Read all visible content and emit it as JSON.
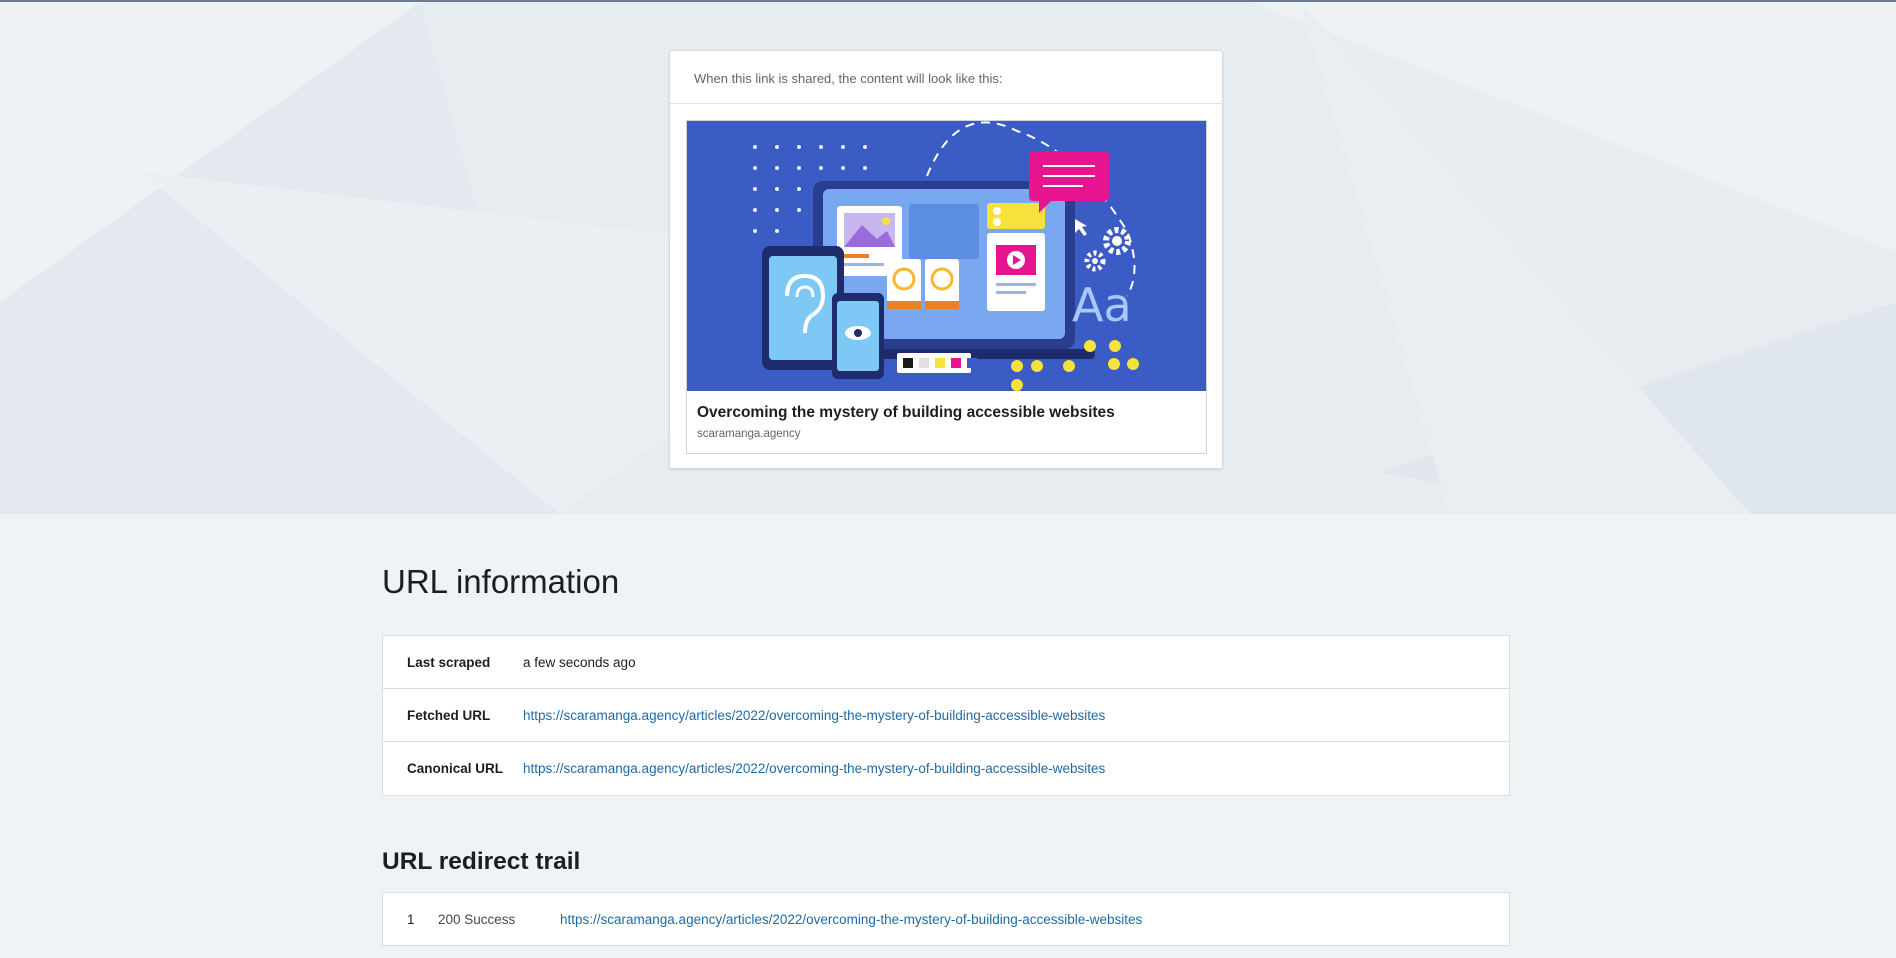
{
  "preview": {
    "header": "When this link is shared, the content will look like this:",
    "title": "Overcoming the mystery of building accessible websites",
    "domain": "scaramanga.agency",
    "image_text": "Aa",
    "colors": {
      "image_bg": "#3b5bc5",
      "accent_magenta": "#e6158f",
      "accent_yellow": "#f5e23b"
    }
  },
  "url_info": {
    "title": "URL information",
    "rows": [
      {
        "label": "Last scraped",
        "value": "a few seconds ago"
      },
      {
        "label": "Fetched URL",
        "value": "https://scaramanga.agency/articles/2022/overcoming-the-mystery-of-building-accessible-websites"
      },
      {
        "label": "Canonical URL",
        "value": "https://scaramanga.agency/articles/2022/overcoming-the-mystery-of-building-accessible-websites"
      }
    ]
  },
  "redirect_trail": {
    "title": "URL redirect trail",
    "rows": [
      {
        "index": "1",
        "status": "200 Success",
        "url": "https://scaramanga.agency/articles/2022/overcoming-the-mystery-of-building-accessible-websites"
      }
    ]
  },
  "colors": {
    "link": "#1f6aa5",
    "page_bg": "#eff3f6"
  }
}
